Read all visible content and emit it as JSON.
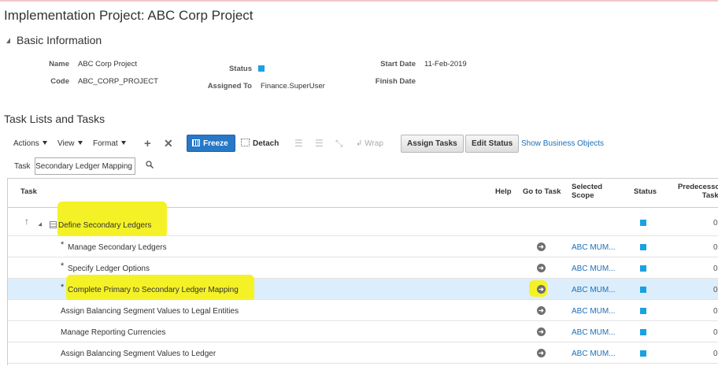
{
  "page": {
    "title": "Implementation Project: ABC Corp Project"
  },
  "basic_info": {
    "section_title": "Basic Information",
    "name_label": "Name",
    "name_value": "ABC Corp Project",
    "code_label": "Code",
    "code_value": "ABC_CORP_PROJECT",
    "status_label": "Status",
    "status_color": "#1ba1e2",
    "assigned_label": "Assigned To",
    "assigned_value": "Finance.SuperUser",
    "start_label": "Start Date",
    "start_value": "11-Feb-2019",
    "finish_label": "Finish Date",
    "finish_value": ""
  },
  "tasks": {
    "section_title": "Task Lists and Tasks",
    "toolbar": {
      "actions": "Actions",
      "view": "View",
      "format": "Format",
      "add_icon": "plus-icon",
      "remove_icon": "x-icon",
      "freeze": "Freeze",
      "detach": "Detach",
      "wrap": "Wrap",
      "assign_tasks": "Assign Tasks",
      "edit_status": "Edit Status",
      "show_business_objects": "Show Business Objects"
    },
    "filter": {
      "label": "Task",
      "value": "Secondary Ledger Mapping"
    },
    "columns": {
      "task": "Task",
      "help": "Help",
      "go_to_task": "Go to Task",
      "selected_scope_1": "Selected",
      "selected_scope_2": "Scope",
      "status": "Status",
      "predecessor_1": "Predecessor",
      "predecessor_2": "Tasks"
    },
    "task_list": {
      "name": "Define Secondary Ledgers",
      "predecessor": "0"
    },
    "rows": [
      {
        "required": "*",
        "name": "Manage Secondary Ledgers",
        "scope": "ABC MUM...",
        "predecessor": "0"
      },
      {
        "required": "*",
        "name": "Specify Ledger Options",
        "scope": "ABC MUM...",
        "predecessor": "0"
      },
      {
        "required": "*",
        "name": "Complete Primary to Secondary Ledger Mapping",
        "scope": "ABC MUM...",
        "predecessor": "0"
      },
      {
        "required": "",
        "name": "Assign Balancing Segment Values to Legal Entities",
        "scope": "ABC MUM...",
        "predecessor": "0"
      },
      {
        "required": "",
        "name": "Manage Reporting Currencies",
        "scope": "ABC MUM...",
        "predecessor": "0"
      },
      {
        "required": "",
        "name": "Assign Balancing Segment Values to Ledger",
        "scope": "ABC MUM...",
        "predecessor": "0"
      }
    ],
    "highlight_color": "#f4f227",
    "status_color": "#1ba1e2",
    "link_color": "#1d6fb8"
  }
}
